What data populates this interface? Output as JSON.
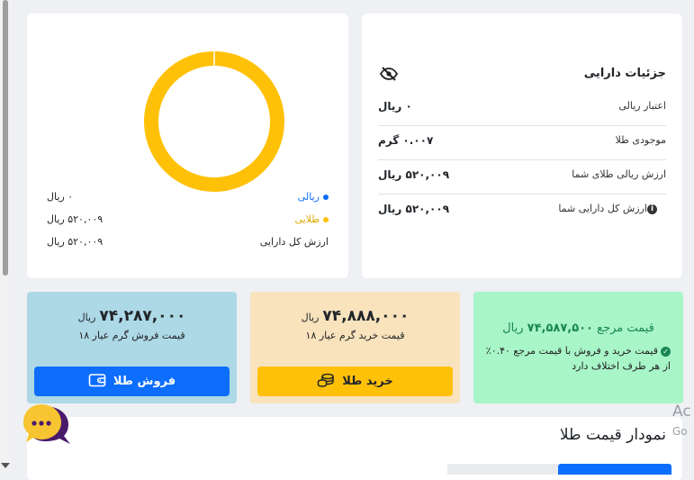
{
  "details": {
    "title": "جزئیات دارایی",
    "rows": [
      {
        "label": "اعتبار ریالی",
        "value": "۰ ریال"
      },
      {
        "label": "موجودی طلا",
        "value": "۰.۰۰۷ گرم"
      },
      {
        "label": "ارزش ریالی طلای شما",
        "value": "۵۲۰,۰۰۹ ریال"
      },
      {
        "label": "ارزش کل دارایی شما",
        "value": "۵۲۰,۰۰۹ ریال"
      }
    ]
  },
  "portfolio": {
    "legend": [
      {
        "label": "ریالی",
        "value": "۰ ریال",
        "color": "#0d6efd"
      },
      {
        "label": "طلایی",
        "value": "۵۲۰,۰۰۹ ریال",
        "color": "#ffc107"
      }
    ],
    "total_label": "ارزش کل دارایی",
    "total_value": "۵۲۰,۰۰۹ ریال"
  },
  "chart_data": {
    "type": "pie",
    "categories": [
      "ریالی",
      "طلایی"
    ],
    "values": [
      0,
      520009
    ],
    "colors": [
      "#0d6efd",
      "#ffc107"
    ],
    "style": "donut"
  },
  "reference": {
    "title_prefix": "قیمت مرجع",
    "price": "۷۴,۵۸۷,۵۰۰",
    "currency": "ریال",
    "note": "قیمت خرید و فروش با قیمت مرجع ۰.۴۰٪ از هر طرف اختلاف دارد"
  },
  "buy": {
    "price": "۷۴,۸۸۸,۰۰۰",
    "currency": "ریال",
    "label": "قیمت خرید گرم عیار ۱۸",
    "button": "خرید طلا"
  },
  "sell": {
    "price": "۷۴,۲۸۷,۰۰۰",
    "currency": "ریال",
    "label": "قیمت فروش گرم عیار ۱۸",
    "button": "فروش طلا"
  },
  "gold_chart": {
    "title": "نمودار قیمت طلا"
  },
  "watermark": {
    "line1": "Ac",
    "line2": "Go"
  },
  "colors": {
    "green": "#198754",
    "blue": "#0d6efd",
    "gold": "#ffc107",
    "chat": "#4a1a6b"
  }
}
